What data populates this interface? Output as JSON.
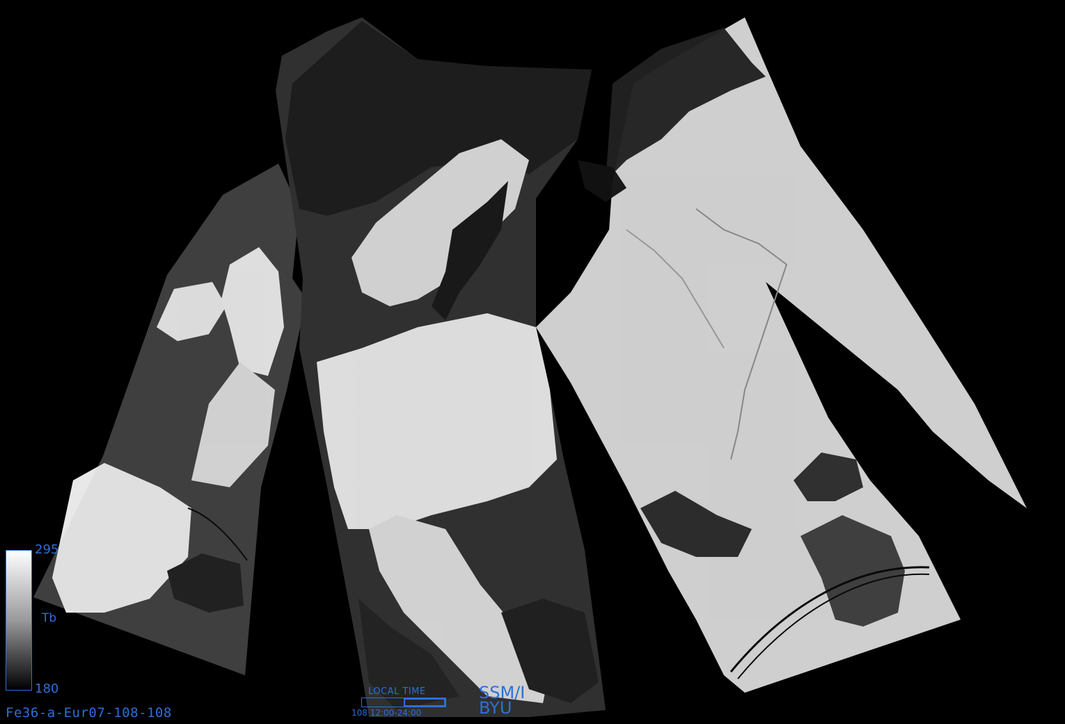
{
  "image_label": "Fe36-a-Eur07-108-108",
  "colorbar": {
    "max": "295",
    "min": "180",
    "variable": "Tb",
    "top_color": "#ffffff",
    "bottom_color": "#000000"
  },
  "time_legend": {
    "title": "LOCAL TIME",
    "text": "108  12:00-24:00",
    "fraction_start": 0.5,
    "fraction_end": 1.0
  },
  "sensor": {
    "line1": "SSM/I",
    "line2": "BYU"
  },
  "colors": {
    "annotation": "#2f6fd6",
    "background": "#000000"
  }
}
